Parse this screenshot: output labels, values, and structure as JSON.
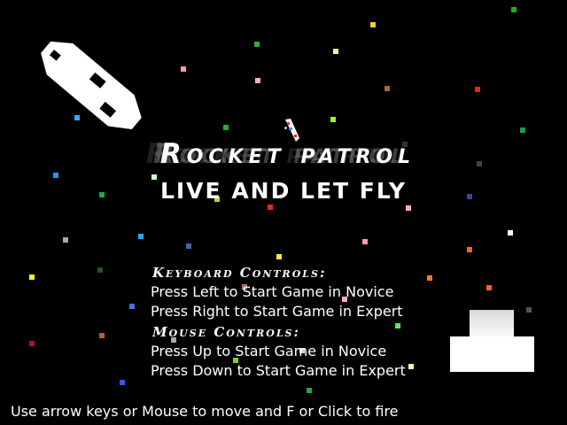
{
  "title": "Rocket patrol",
  "subtitle": "Live and let fly",
  "keyboard_controls": {
    "heading": "Keyboard Controls:",
    "lines": [
      "Press Left to Start Game in Novice",
      "Press Right to Start Game in Expert"
    ]
  },
  "mouse_controls": {
    "heading": "Mouse Controls:",
    "lines": [
      "Press Up to Start Game in Novice",
      "Press Down to Start Game in Expert"
    ]
  },
  "footer": "Use arrow keys or Mouse to move and F or Click to fire",
  "colors": {
    "background": "#000000",
    "text": "#ffffff",
    "spaceship": "#ffffff",
    "rocket": "#ffffff"
  },
  "icons": {
    "spaceship": "spaceship-icon",
    "rocket": "rocket-icon",
    "player-block": "player-block-icon"
  }
}
